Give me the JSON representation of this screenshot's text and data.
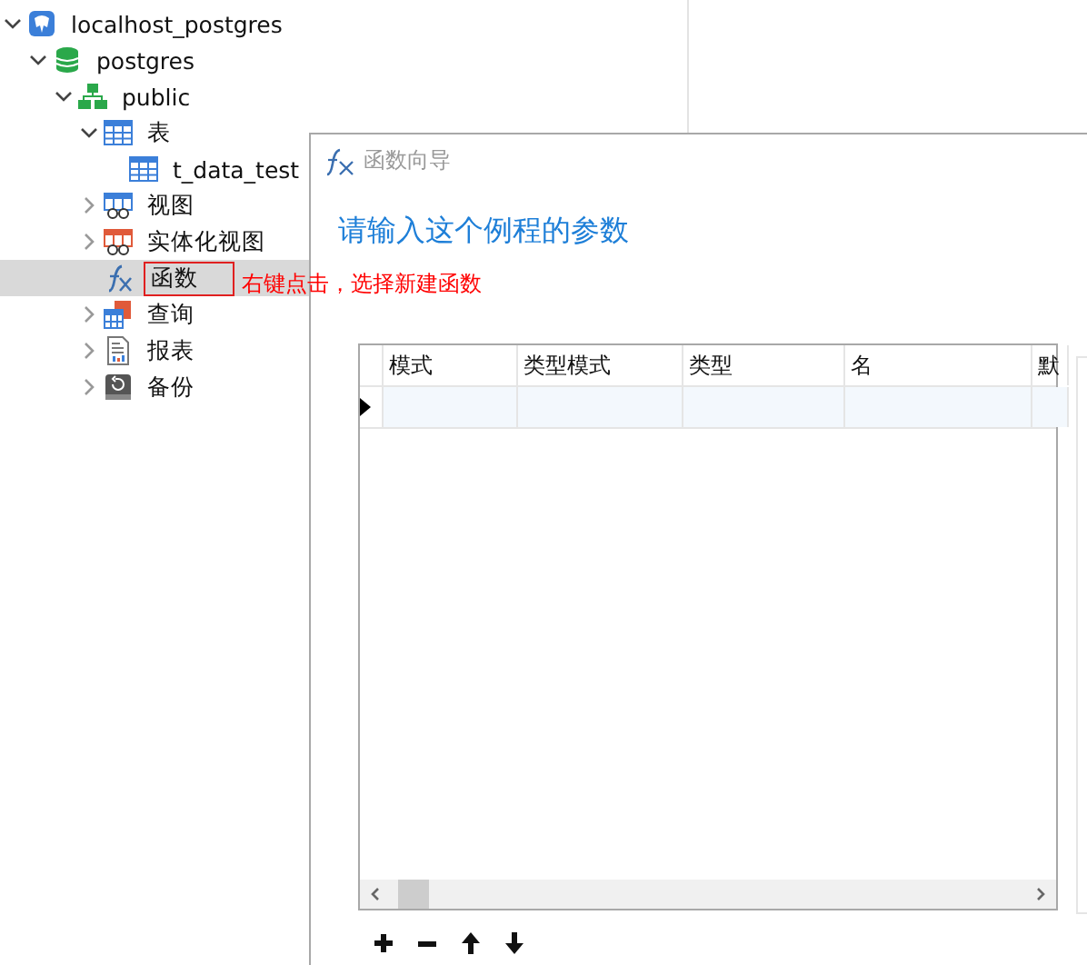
{
  "tree": [
    {
      "label": "localhost_postgres",
      "kind": "server",
      "expanded": true,
      "selected": false,
      "children": [
        {
          "label": "postgres",
          "kind": "database",
          "expanded": true,
          "selected": false,
          "children": [
            {
              "label": "public",
              "kind": "schema",
              "expanded": true,
              "selected": false,
              "children": [
                {
                  "label": "表",
                  "kind": "table",
                  "expanded": true,
                  "selected": false,
                  "children": [
                    {
                      "label": "t_data_test",
                      "kind": "table",
                      "selected": false
                    }
                  ]
                },
                {
                  "label": "视图",
                  "kind": "view",
                  "expanded": false,
                  "selected": false
                },
                {
                  "label": "实体化视图",
                  "kind": "matview",
                  "expanded": false,
                  "selected": false
                },
                {
                  "label": "函数",
                  "kind": "function",
                  "selected": true,
                  "boxed": true
                },
                {
                  "label": "查询",
                  "kind": "query",
                  "expanded": false,
                  "selected": false
                },
                {
                  "label": "报表",
                  "kind": "report",
                  "expanded": false,
                  "selected": false
                },
                {
                  "label": "备份",
                  "kind": "backup",
                  "expanded": false,
                  "selected": false
                }
              ]
            }
          ]
        }
      ]
    }
  ],
  "annotation": {
    "text": "右键点击，选择新建函数"
  },
  "dialog": {
    "title": "函数向导",
    "heading": "请输入这个例程的参数",
    "table": {
      "columns": [
        "模式",
        "类型模式",
        "类型",
        "名",
        "默"
      ]
    }
  }
}
